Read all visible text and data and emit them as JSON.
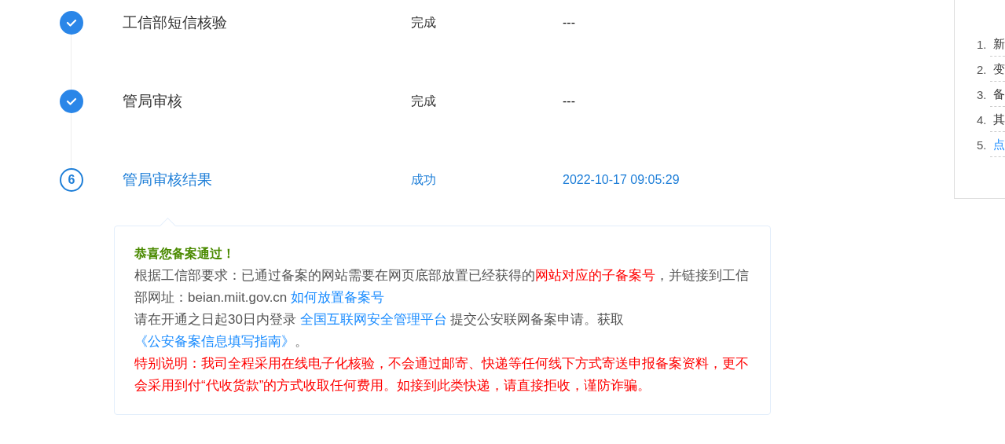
{
  "steps": [
    {
      "completed": true,
      "title": "工信部短信核验",
      "status": "完成",
      "time": "---"
    },
    {
      "completed": true,
      "title": "管局审核",
      "status": "完成",
      "time": "---"
    },
    {
      "completed": false,
      "number": "6",
      "title": "管局审核结果",
      "status": "成功",
      "time": "2022-10-17 09:05:29"
    }
  ],
  "notice": {
    "heading": "恭喜您备案通过！",
    "paragraphs": [
      {
        "kind": "normal",
        "segments": [
          {
            "kind": "text",
            "text": "根据工信部要求：已通过备案的网站需要在网页底部放置已经获得的"
          },
          {
            "kind": "red",
            "text": "网站对应的子备案号"
          },
          {
            "kind": "text",
            "text": "，并链接到工信部网址：beian.miit.gov.cn "
          },
          {
            "kind": "link",
            "text": "如何放置备案号"
          }
        ]
      },
      {
        "kind": "normal",
        "segments": [
          {
            "kind": "text",
            "text": "请在开通之日起30日内登录 "
          },
          {
            "kind": "link",
            "text": "全国互联网安全管理平台"
          },
          {
            "kind": "text",
            "text": " 提交公安联网备案申请。获取"
          },
          {
            "kind": "link",
            "text": "《公安备案信息填写指南》"
          },
          {
            "kind": "text",
            "text": "。"
          }
        ]
      },
      {
        "kind": "warning",
        "segments": [
          {
            "kind": "text",
            "text": "特别说明：我司全程采用在线电子化核验，不会通过邮寄、快递等任何线下方式寄送申报备案资料，更不会采用到付“代收货款”的方式收取任何费用。如接到此类快递，请直接拒收，谨防诈骗。"
          }
        ]
      }
    ]
  },
  "sidebar": {
    "items": [
      {
        "kind": "text",
        "number": "1.",
        "text": "新"
      },
      {
        "kind": "text",
        "number": "2.",
        "text": "变"
      },
      {
        "kind": "text",
        "number": "3.",
        "text": "备"
      },
      {
        "kind": "text",
        "number": "4.",
        "text": "其"
      },
      {
        "kind": "link",
        "number": "5.",
        "text": "点"
      }
    ]
  }
}
